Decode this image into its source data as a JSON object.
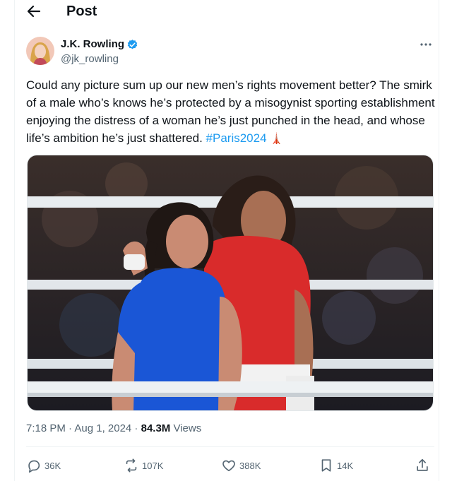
{
  "header": {
    "title": "Post",
    "back_icon": "arrow-left-icon"
  },
  "post": {
    "author": {
      "name": "J.K. Rowling",
      "handle": "@jk_rowling",
      "verified": true
    },
    "text": "Could any picture sum up our new men’s rights movement better? The smirk of a male who’s knows he’s protected by a misogynist sporting establishment enjoying the distress of a woman he’s just punched in the head, and whose life’s ambition he’s just shattered.",
    "hashtag": "#Paris2024",
    "emoji": "🗼",
    "timestamp": "7:18 PM · Aug 1, 2024 · ",
    "views_count": "84.3M",
    "views_label": "Views"
  },
  "actions": {
    "replies": "36K",
    "reposts": "107K",
    "likes": "388K",
    "bookmarks": "14K"
  },
  "colors": {
    "accent": "#1d9bf0",
    "text": "#0f1419",
    "muted": "#536471",
    "blue_kit": "#1a56d6",
    "red_kit": "#d92b2b"
  }
}
